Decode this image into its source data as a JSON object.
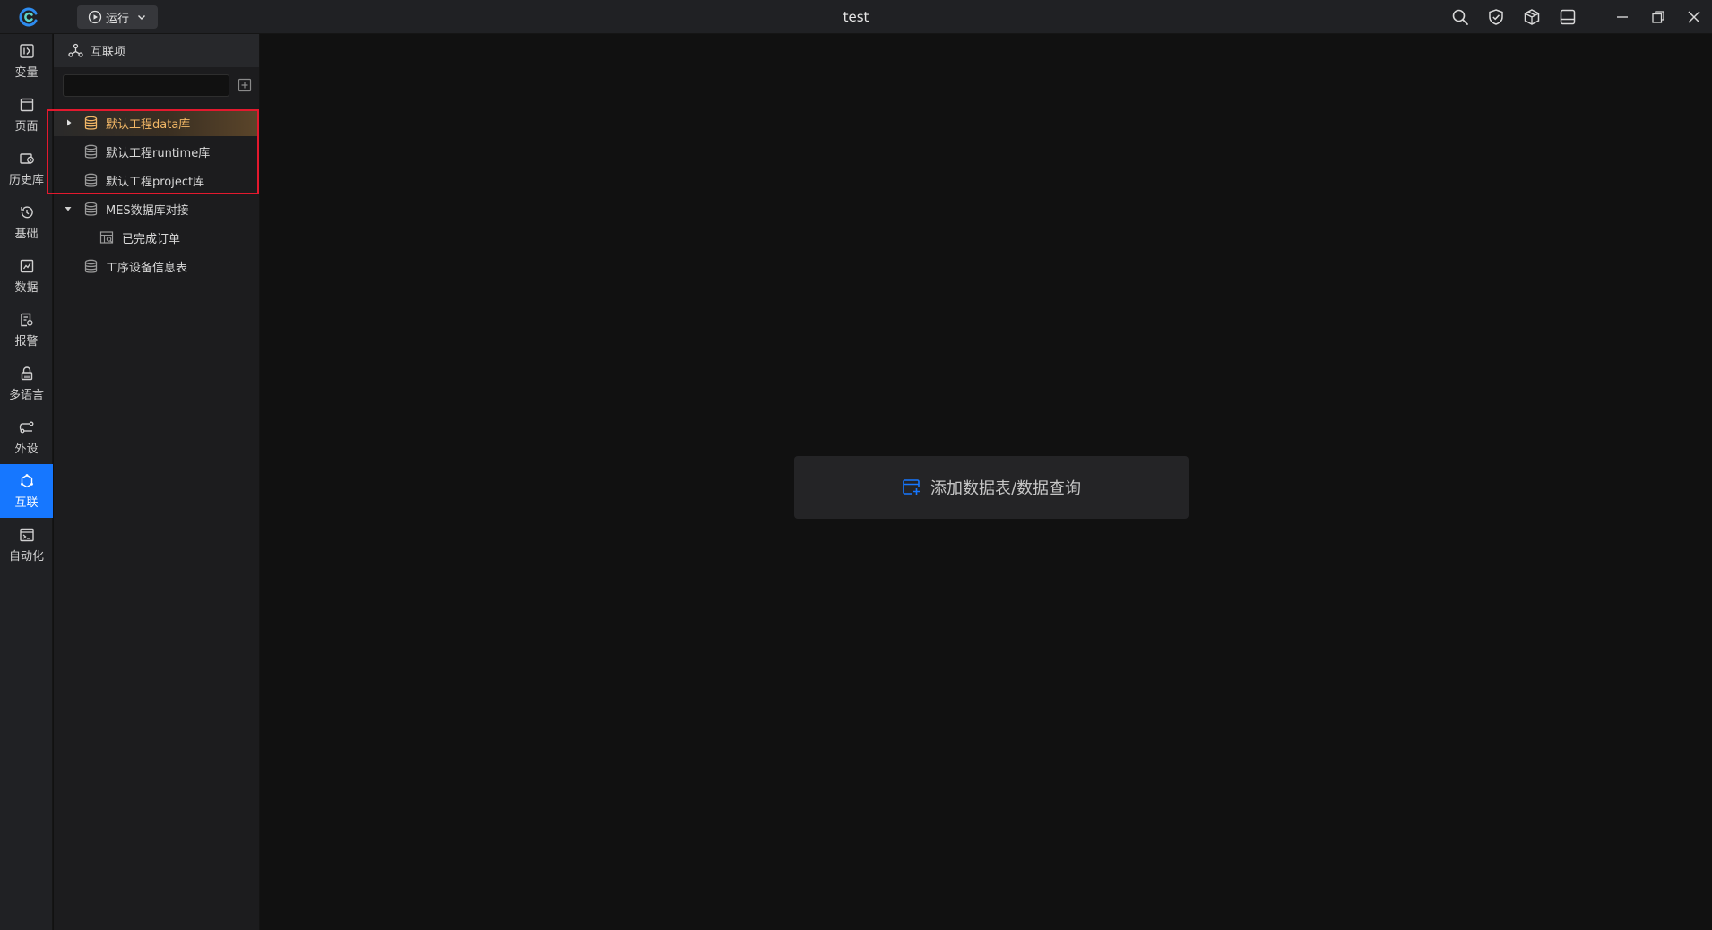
{
  "titlebar": {
    "title": "test",
    "run_label": "运行"
  },
  "rail": {
    "items": [
      {
        "label": "变量",
        "icon": "variable-icon"
      },
      {
        "label": "页面",
        "icon": "page-icon"
      },
      {
        "label": "历史库",
        "icon": "history-db-icon"
      },
      {
        "label": "基础",
        "icon": "basic-icon"
      },
      {
        "label": "数据",
        "icon": "data-icon"
      },
      {
        "label": "报警",
        "icon": "alarm-icon"
      },
      {
        "label": "多语言",
        "icon": "language-icon"
      },
      {
        "label": "外设",
        "icon": "peripheral-icon"
      },
      {
        "label": "互联",
        "icon": "interconnect-icon",
        "active": true
      },
      {
        "label": "自动化",
        "icon": "automation-icon"
      }
    ]
  },
  "panel": {
    "header": "互联项",
    "search": {
      "value": "",
      "placeholder": ""
    },
    "tree": [
      {
        "label": "默认工程data库",
        "level": 0,
        "expandable": true,
        "expanded": false,
        "selected": true
      },
      {
        "label": "默认工程runtime库",
        "level": 0,
        "expandable": false
      },
      {
        "label": "默认工程project库",
        "level": 0,
        "expandable": false
      },
      {
        "label": "MES数据库对接",
        "level": 0,
        "expandable": true,
        "expanded": true
      },
      {
        "label": "已完成订单",
        "level": 1,
        "expandable": false
      },
      {
        "label": "工序设备信息表",
        "level": 0,
        "expandable": false
      }
    ]
  },
  "main": {
    "add_button_label": "添加数据表/数据查询"
  },
  "colors": {
    "accent": "#1677ff",
    "selected_text": "#f2b766",
    "highlight_border": "#e3192e"
  }
}
